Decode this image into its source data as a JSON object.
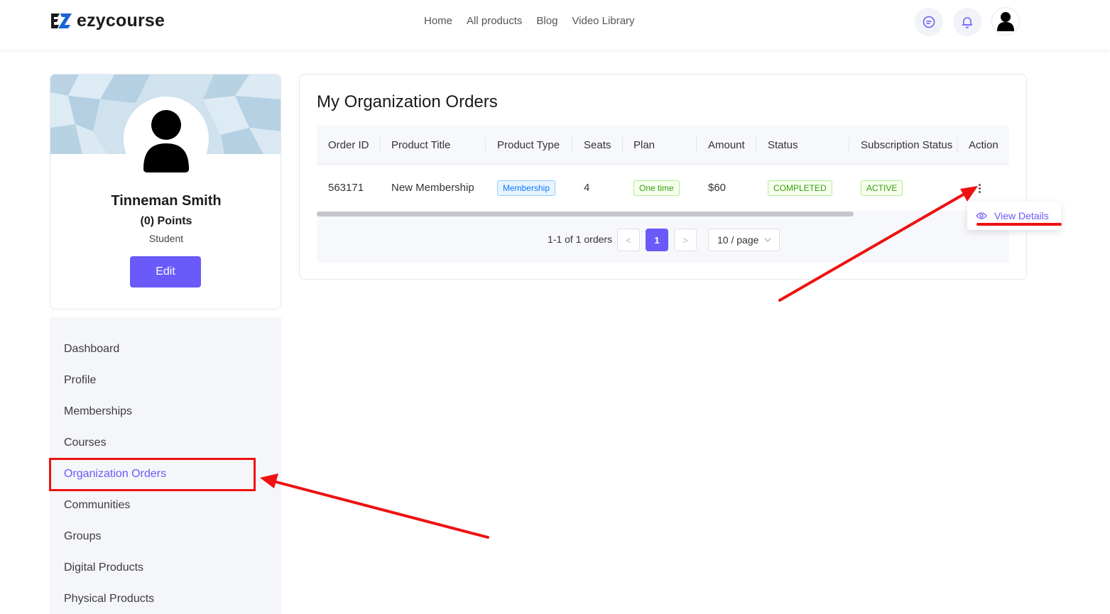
{
  "header": {
    "logo_text": "ezycourse",
    "nav": [
      "Home",
      "All products",
      "Blog",
      "Video Library"
    ],
    "icons": [
      "chat-icon",
      "bell-icon",
      "user-avatar-icon"
    ]
  },
  "profile": {
    "name": "Tinneman Smith",
    "points": "(0) Points",
    "role": "Student",
    "edit_label": "Edit"
  },
  "sidebar": {
    "items": [
      "Dashboard",
      "Profile",
      "Memberships",
      "Courses",
      "Organization Orders",
      "Communities",
      "Groups",
      "Digital Products",
      "Physical Products"
    ],
    "active": "Organization Orders"
  },
  "orders": {
    "title": "My Organization Orders",
    "columns": [
      "Order ID",
      "Product Title",
      "Product Type",
      "Seats",
      "Plan",
      "Amount",
      "Status",
      "Subscription Status",
      "Action"
    ],
    "rows": [
      {
        "order_id": "563171",
        "product_title": "New Membership",
        "product_type": "Membership",
        "seats": "4",
        "plan": "One time",
        "amount": "$60",
        "status": "COMPLETED",
        "subscription_status": "ACTIVE"
      }
    ],
    "pagination": {
      "info": "1-1 of 1 orders",
      "prev": "<",
      "current_page": "1",
      "next": ">",
      "page_size": "10 / page"
    }
  },
  "action_menu": {
    "view_details_label": "View Details"
  },
  "colors": {
    "accent": "#6a5af9",
    "annotation": "#ee1111"
  }
}
